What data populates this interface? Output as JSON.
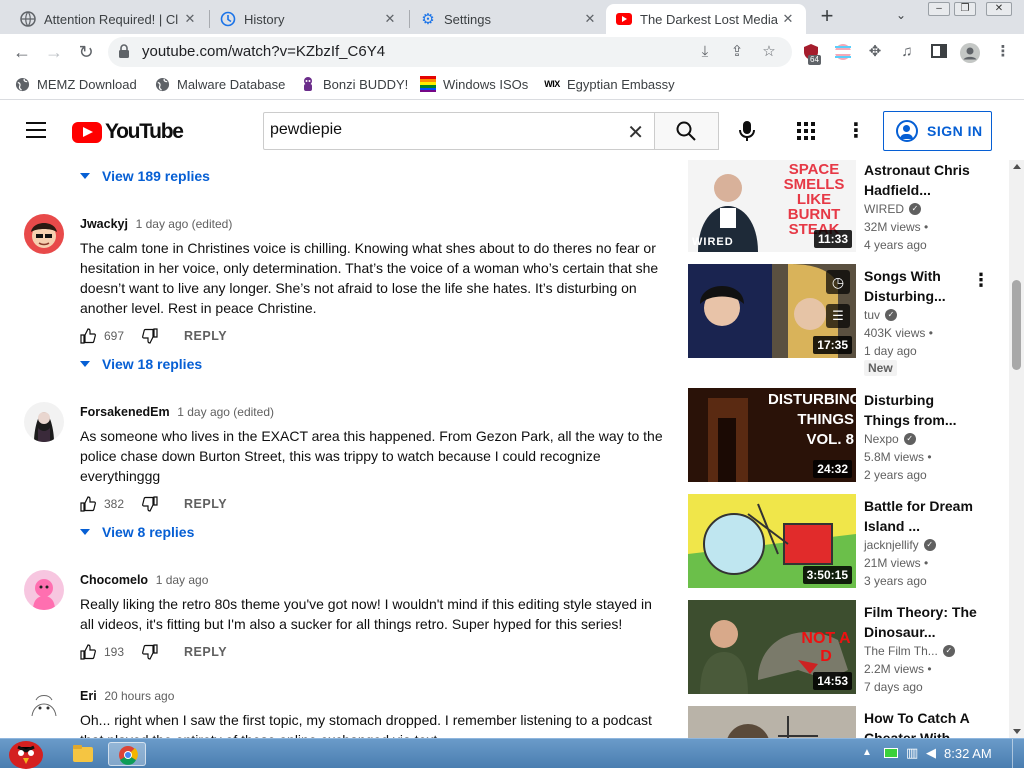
{
  "browser": {
    "tabs": [
      {
        "title": "Attention Required! | Cl",
        "icon": "globe-icon"
      },
      {
        "title": "History",
        "icon": "history-icon"
      },
      {
        "title": "Settings",
        "icon": "gear-icon"
      },
      {
        "title": "The Darkest Lost Media",
        "icon": "youtube-icon",
        "active": true
      }
    ],
    "url": "youtube.com/watch?v=KZbzIf_C6Y4",
    "extension_badge": "64",
    "bookmarks": [
      {
        "label": "MEMZ Download",
        "icon": "globe-icon"
      },
      {
        "label": "Malware Database",
        "icon": "globe-icon"
      },
      {
        "label": "Bonzi BUDDY!",
        "icon": "bonzi-icon"
      },
      {
        "label": "Windows ISOs",
        "icon": "windows-icon"
      },
      {
        "label": "Egyptian Embassy",
        "icon": "wix-icon"
      }
    ]
  },
  "youtube": {
    "logo_text": "YouTube",
    "search_value": "pewdiepie",
    "sign_in_label": "SIGN IN"
  },
  "comments": {
    "top_view_replies": "View 189 replies",
    "items": [
      {
        "author": "Jwackyj",
        "time": "1 day ago (edited)",
        "text": "The calm tone in Christines voice is chilling. Knowing what shes about to do theres no fear or hesitation in her voice, only determination. That’s the voice of a woman who’s certain that she doesn’t want to live any longer. She’s not afraid to lose the life she hates. It’s disturbing on another level. Rest in peace Christine.",
        "likes": "697",
        "reply_label": "REPLY",
        "view_replies": "View 18 replies"
      },
      {
        "author": "ForsakenedEm",
        "time": "1 day ago (edited)",
        "text": "As someone who lives in the EXACT area this happened. From Gezon Park, all the way to the police chase down Burton Street, this was trippy to watch because I could recognize everythinggg",
        "likes": "382",
        "reply_label": "REPLY",
        "view_replies": "View 8 replies"
      },
      {
        "author": "Chocomelo",
        "time": "1 day ago",
        "text": "Really liking the retro 80s theme you've got now! I wouldn't mind if this editing style stayed in all videos, it's fitting but I'm also a sucker for all things retro. Super hyped for this series!",
        "likes": "193",
        "reply_label": "REPLY"
      },
      {
        "author": "Eri",
        "time": "20 hours ago",
        "text": "Oh... right when I saw the first topic, my stomach dropped. I remember listening to a podcast that played the entirety of these online exchanged via text-"
      }
    ]
  },
  "sidebar": {
    "videos": [
      {
        "title": "Astronaut Chris Hadfield...",
        "channel": "WIRED",
        "verified": true,
        "views": "32M views •",
        "ago": "4 years ago",
        "duration": "11:33",
        "thumb_text": "SPACE SMELLS LIKE BURNT STEAK",
        "thumb_watermark": "WIRED"
      },
      {
        "title": "Songs With Disturbing...",
        "channel": "tuv",
        "verified": true,
        "views": "403K views •",
        "ago": "1 day ago",
        "badge": "New",
        "duration": "17:35"
      },
      {
        "title": "Disturbing Things from...",
        "channel": "Nexpo",
        "verified": true,
        "views": "5.8M views •",
        "ago": "2 years ago",
        "duration": "24:32",
        "thumb_text": "DISTURBING THINGS VOL. 8"
      },
      {
        "title": "Battle for Dream Island ...",
        "channel": "jacknjellify",
        "verified": true,
        "views": "21M views •",
        "ago": "3 years ago",
        "duration": "3:50:15"
      },
      {
        "title": "Film Theory: The Dinosaur...",
        "channel": "The Film Th...",
        "verified": true,
        "views": "2.2M views •",
        "ago": "7 days ago",
        "duration": "14:53",
        "thumb_text": "NOT A D"
      },
      {
        "title": "How To Catch A Cheater With..."
      }
    ]
  },
  "taskbar": {
    "clock": "8:32 AM"
  },
  "colors": {
    "youtube_red": "#ff0000",
    "link_blue": "#065fd4",
    "taskbar": "#5a8cbf"
  }
}
